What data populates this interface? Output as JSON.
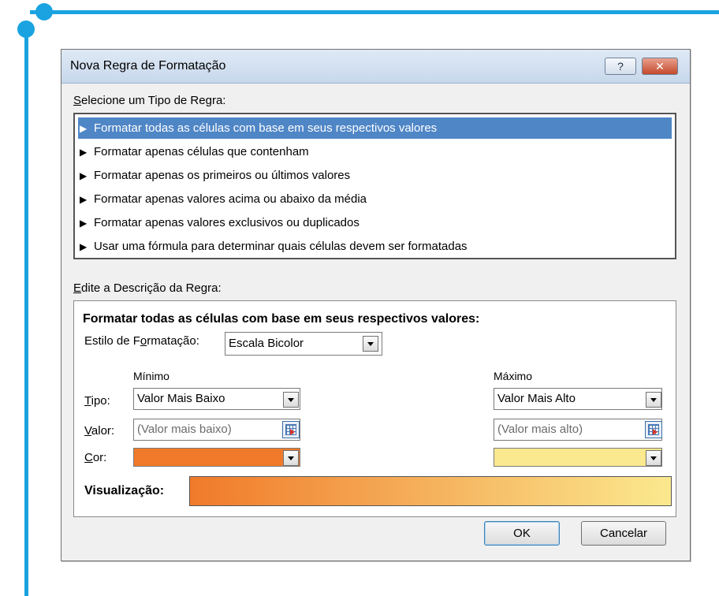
{
  "dialog": {
    "title": "Nova Regra de Formatação",
    "help_label": "?",
    "close_label": "✕"
  },
  "rule_type": {
    "label_prefix": "",
    "label_hotkey": "S",
    "label_rest": "elecione um Tipo de Regra:",
    "items": [
      {
        "label": "Formatar todas as células com base em seus respectivos valores",
        "selected": true
      },
      {
        "label": "Formatar apenas células que contenham",
        "selected": false
      },
      {
        "label": "Formatar apenas os primeiros ou últimos valores",
        "selected": false
      },
      {
        "label": "Formatar apenas valores acima ou abaixo da média",
        "selected": false
      },
      {
        "label": "Formatar apenas valores exclusivos ou duplicados",
        "selected": false
      },
      {
        "label": "Usar uma fórmula para determinar quais células devem ser formatadas",
        "selected": false
      }
    ]
  },
  "description": {
    "label_hotkey": "E",
    "label_rest": "dite a Descrição da Regra:",
    "heading": "Formatar todas as células com base em seus respectivos valores:",
    "style_label_a": "Estilo de F",
    "style_label_hotkey": "o",
    "style_label_b": "rmatação:",
    "style_value": "Escala Bicolor",
    "min_header": "Mínimo",
    "max_header": "Máximo",
    "tipo_hotkey": "T",
    "tipo_rest": "ipo:",
    "valor_hotkey": "V",
    "valor_rest": "alor:",
    "cor_hotkey": "C",
    "cor_rest": "or:",
    "min_type": "Valor Mais Baixo",
    "max_type": "Valor Mais Alto",
    "min_value_placeholder": "(Valor mais baixo)",
    "max_value_placeholder": "(Valor mais alto)",
    "min_color": "#f07a2a",
    "max_color": "#fbe98f",
    "preview_label": "Visualização:"
  },
  "buttons": {
    "ok": "OK",
    "cancel": "Cancelar"
  }
}
